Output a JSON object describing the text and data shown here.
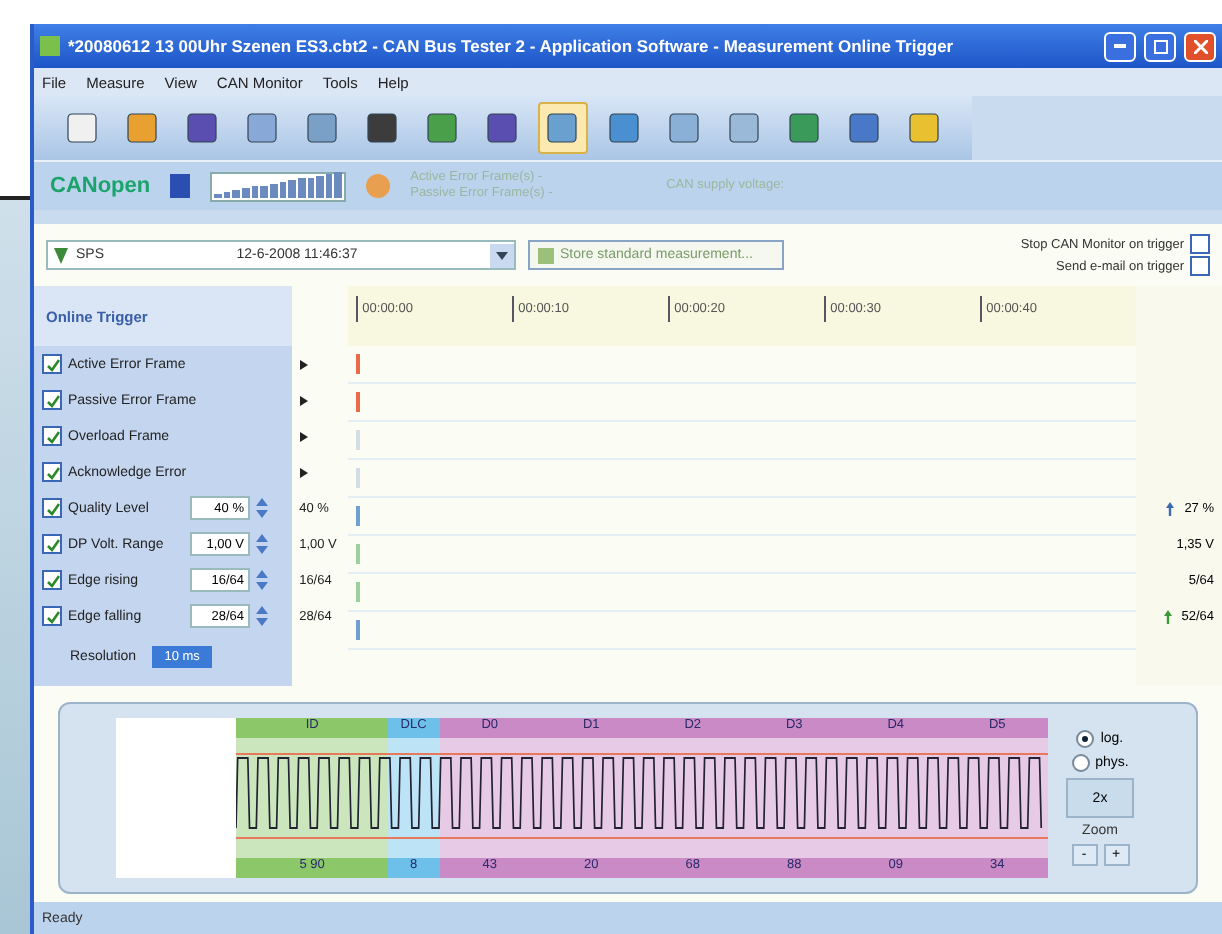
{
  "window": {
    "title": "*20080612 13 00Uhr Szenen ES3.cbt2 - CAN Bus Tester 2 - Application Software - Measurement Online Trigger"
  },
  "menu": [
    "File",
    "Measure",
    "View",
    "CAN Monitor",
    "Tools",
    "Help"
  ],
  "info_bar": {
    "logo": "CANopen",
    "error_lines": [
      "Active Error Frame(s) -",
      "Passive Error Frame(s) -"
    ],
    "supply": "CAN supply voltage:"
  },
  "controls": {
    "source": "SPS",
    "timestamp": "12-6-2008 11:46:37",
    "store_button": "Store standard measurement...",
    "options": [
      {
        "label": "Stop CAN Monitor on trigger",
        "checked": false
      },
      {
        "label": "Send e-mail on trigger",
        "checked": false
      }
    ]
  },
  "trigger": {
    "title": "Online Trigger",
    "ticks": [
      "00:00:00",
      "00:00:10",
      "00:00:20",
      "00:00:30",
      "00:00:40"
    ],
    "rows": [
      {
        "kind": "event",
        "label": "Active Error Frame",
        "checked": true,
        "hit": true
      },
      {
        "kind": "event",
        "label": "Passive Error Frame",
        "checked": true,
        "hit": true
      },
      {
        "kind": "event",
        "label": "Overload Frame",
        "checked": true,
        "hit": false
      },
      {
        "kind": "event",
        "label": "Acknowledge Error",
        "checked": true,
        "hit": false
      },
      {
        "kind": "value",
        "label": "Quality Level",
        "checked": true,
        "setting": "40 %",
        "threshold": "40 %",
        "current": "27 %",
        "alarm": true
      },
      {
        "kind": "value",
        "label": "DP Volt. Range",
        "checked": true,
        "setting": "1,00 V",
        "threshold": "1,00 V",
        "current": "1,35 V",
        "alarm": false
      },
      {
        "kind": "value",
        "label": "Edge rising",
        "checked": true,
        "setting": "16/64",
        "threshold": "16/64",
        "current": "5/64",
        "alarm": false
      },
      {
        "kind": "value",
        "label": "Edge falling",
        "checked": true,
        "setting": "28/64",
        "threshold": "28/64",
        "current": "52/64",
        "alarm": true
      }
    ],
    "resolution_label": "Resolution",
    "resolution": "10 ms"
  },
  "scope": {
    "segments": [
      {
        "kind": "id",
        "label": "ID",
        "value": "5 90"
      },
      {
        "kind": "dlc",
        "label": "DLC",
        "value": "8"
      },
      {
        "kind": "data",
        "label": "D0",
        "value": "43"
      },
      {
        "kind": "data",
        "label": "D1",
        "value": "20"
      },
      {
        "kind": "data",
        "label": "D2",
        "value": "68"
      },
      {
        "kind": "data",
        "label": "D3",
        "value": "88"
      },
      {
        "kind": "data",
        "label": "D4",
        "value": "09"
      },
      {
        "kind": "data",
        "label": "D5",
        "value": "34"
      }
    ],
    "modes": [
      {
        "label": "log.",
        "selected": true
      },
      {
        "label": "phys.",
        "selected": false
      }
    ],
    "zoom_value": "2x",
    "zoom_label": "Zoom",
    "zoom_buttons": [
      "-",
      "+"
    ]
  },
  "status_bar": {
    "text": "Ready"
  }
}
